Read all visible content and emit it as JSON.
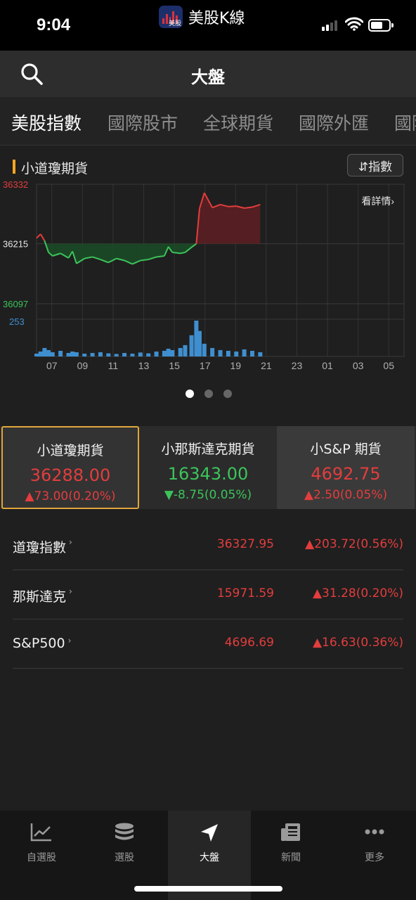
{
  "status": {
    "time": "9:04",
    "app_name": "美股K線",
    "app_icon_text": "美股"
  },
  "header": {
    "title": "大盤",
    "search_icon": "search-icon"
  },
  "tabs": [
    {
      "label": "美股指數",
      "active": true
    },
    {
      "label": "國際股市",
      "active": false
    },
    {
      "label": "全球期貨",
      "active": false
    },
    {
      "label": "國際外匯",
      "active": false
    },
    {
      "label": "國際",
      "active": false
    }
  ],
  "chart": {
    "title": "小道瓊期貨",
    "toggle_label": "⇵指數",
    "detail_link": "看詳情",
    "pages": 3,
    "current_page": 0
  },
  "chart_data": {
    "type": "line",
    "title": "",
    "reference_value": 36215,
    "ylim": [
      36097,
      36332
    ],
    "y_tick_labels": [
      "36332",
      "36215",
      "36097"
    ],
    "volume_label": "253",
    "x_tick_labels": [
      "07",
      "09",
      "11",
      "13",
      "15",
      "17",
      "19",
      "21",
      "23",
      "01",
      "03",
      "05"
    ],
    "series": [
      {
        "x": [
          7.0,
          7.25,
          7.5,
          7.75,
          8.0,
          8.5,
          9.0,
          9.25,
          9.5,
          10.0,
          10.5,
          11.0,
          11.5,
          12.0,
          12.5,
          13.0,
          13.5,
          14.0,
          14.5,
          15.0,
          15.25,
          15.5,
          16.0,
          16.3,
          16.7,
          17.0,
          17.2,
          17.5,
          18.0,
          18.5,
          19.0,
          19.5,
          20.0,
          20.5,
          21.0
        ],
        "y": [
          36226,
          36234,
          36221,
          36198,
          36191,
          36196,
          36187,
          36200,
          36176,
          36186,
          36189,
          36184,
          36178,
          36186,
          36182,
          36175,
          36182,
          36184,
          36189,
          36191,
          36209,
          36198,
          36196,
          36198,
          36208,
          36215,
          36284,
          36315,
          36286,
          36292,
          36288,
          36289,
          36285,
          36287,
          36292
        ]
      }
    ],
    "volume": [
      20,
      35,
      60,
      45,
      30,
      40,
      25,
      35,
      30,
      20,
      25,
      30,
      22,
      18,
      25,
      20,
      28,
      22,
      35,
      40,
      55,
      45,
      60,
      80,
      150,
      253,
      180,
      90,
      60,
      45,
      40,
      35,
      50,
      40,
      30
    ],
    "colors": {
      "up": "#e33d3d",
      "down": "#3cc45b",
      "volume": "#3f8fd0",
      "up_fill": "#5a1e22",
      "down_fill": "#1b4a26"
    },
    "grid": true
  },
  "cards": [
    {
      "name": "小道瓊期貨",
      "price": "36288.00",
      "change": "▲73.00(0.20%)",
      "color": "red",
      "selected": true
    },
    {
      "name": "小那斯達克期貨",
      "price": "16343.00",
      "change": "▼-8.75(0.05%)",
      "color": "green",
      "selected": false
    },
    {
      "name": "小S&P 期貨",
      "price": "4692.75",
      "change": "▲2.50(0.05%)",
      "color": "red",
      "selected": false
    }
  ],
  "indices": [
    {
      "name": "道瓊指數",
      "value": "36327.95",
      "change": "▲203.72(0.56%)"
    },
    {
      "name": "那斯達克",
      "value": "15971.59",
      "change": "▲31.28(0.20%)"
    },
    {
      "name": "S&P500",
      "value": "4696.69",
      "change": "▲16.63(0.36%)"
    }
  ],
  "tabbar": [
    {
      "label": "自選股",
      "icon": "line-chart-icon",
      "active": false
    },
    {
      "label": "選股",
      "icon": "coin-stack-icon",
      "active": false
    },
    {
      "label": "大盤",
      "icon": "navigation-arrow-icon",
      "active": true
    },
    {
      "label": "新聞",
      "icon": "newspaper-icon",
      "active": false
    },
    {
      "label": "更多",
      "icon": "more-dots-icon",
      "active": false
    }
  ]
}
